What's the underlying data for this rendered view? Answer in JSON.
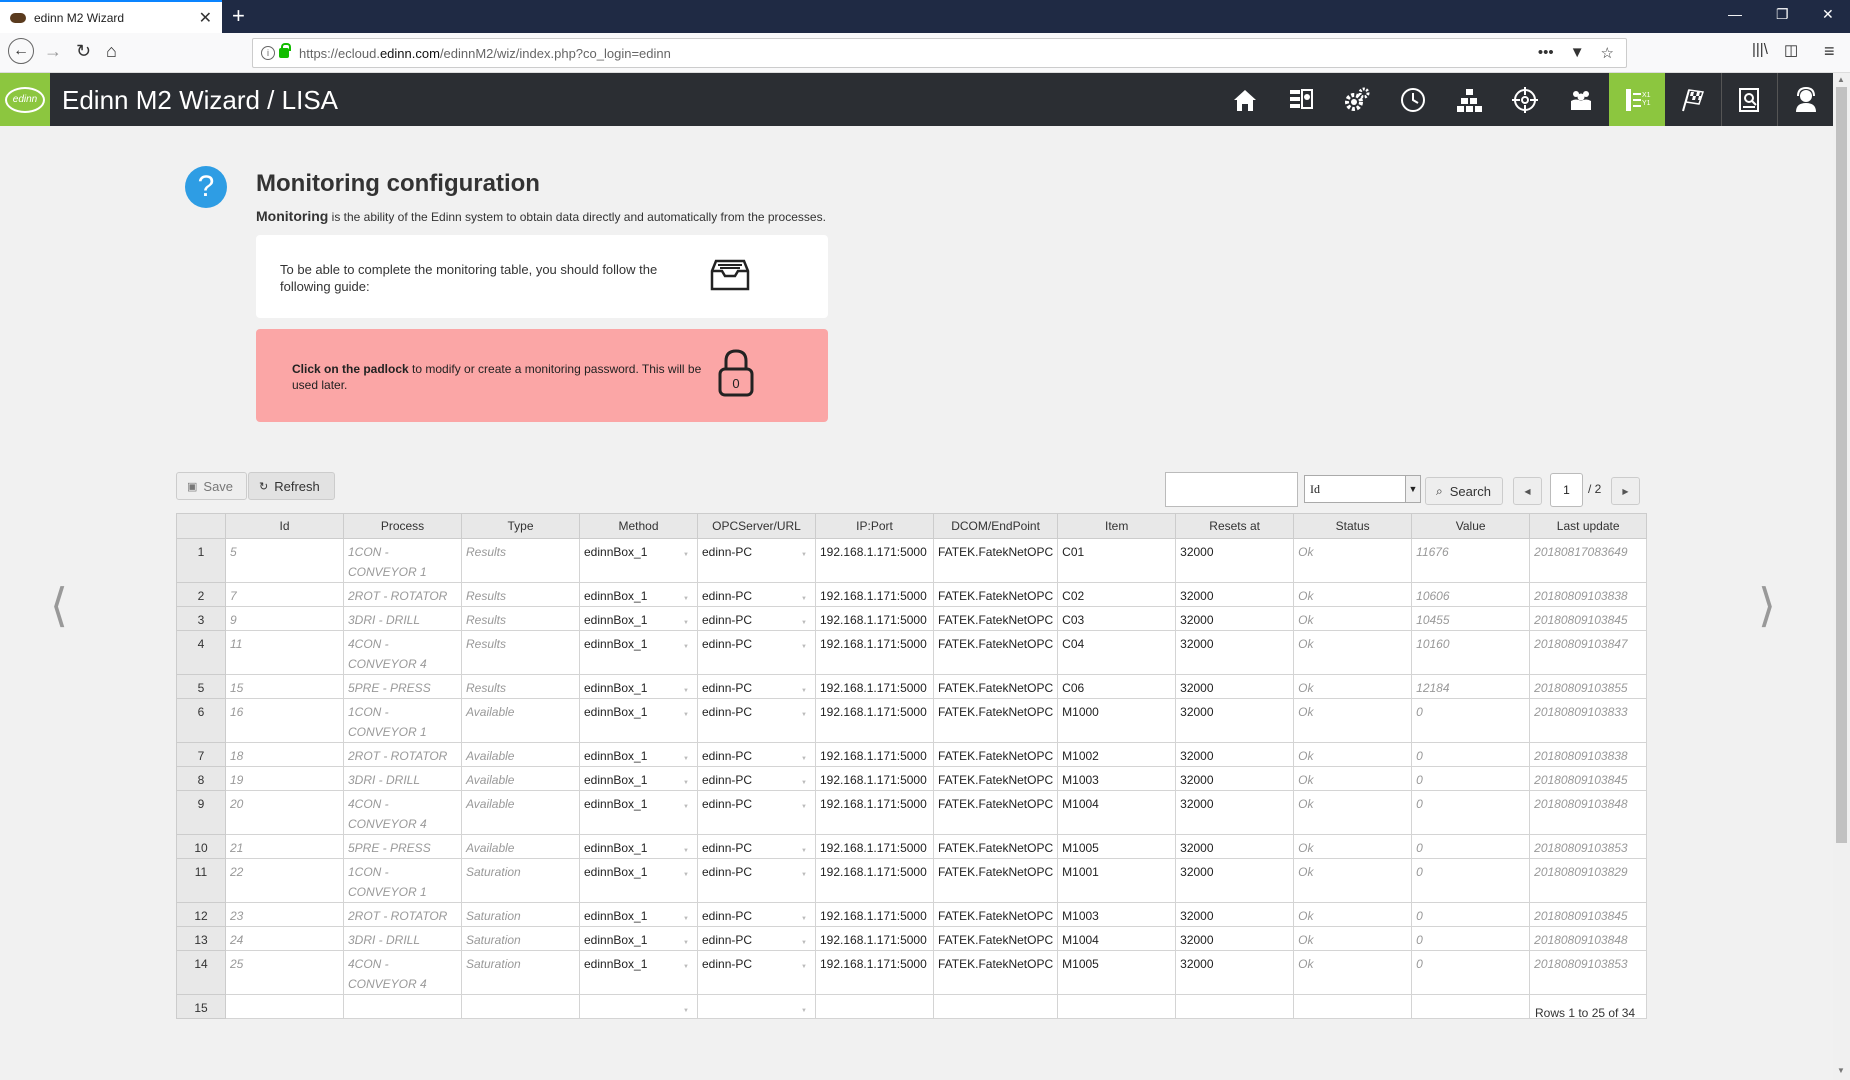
{
  "browser": {
    "tab_title": "edinn M2 Wizard",
    "url_prefix": "https://ecloud.",
    "url_domain": "edinn.com",
    "url_path": "/edinnM2/wiz/index.php?co_login=edinn"
  },
  "app": {
    "logo_text": "edinn",
    "title": "Edinn M2 Wizard / LISA",
    "nav_icons": [
      "home-icon",
      "dashboard-icon",
      "settings-gears-icon",
      "clock-icon",
      "hierarchy-icon",
      "target-icon",
      "users-icon",
      "monitoring-icon",
      "race-flag-icon",
      "report-icon",
      "support-icon"
    ],
    "active_icon": "monitoring-icon",
    "accent_color": "#8cc63f"
  },
  "page": {
    "title": "Monitoring configuration",
    "intro_bold": "Monitoring",
    "intro_rest": " is the ability of the Edinn system to obtain data directly and automatically from the processes.",
    "guide_text": "To be able to complete the monitoring table, you should follow the following guide:",
    "alert_bold": "Click on the padlock",
    "alert_rest": " to modify or create a monitoring password. This will be used later.",
    "padlock_number": "0",
    "alert_color": "#fba6a6"
  },
  "toolbar": {
    "save_label": "Save",
    "refresh_label": "Refresh",
    "search_value": "",
    "search_field": "Id",
    "search_label": "Search",
    "page_current": "1",
    "page_total": "/ 2"
  },
  "table": {
    "columns": [
      "",
      "Id",
      "Process",
      "Type",
      "Method",
      "OPCServer/URL",
      "IP:Port",
      "DCOM/EndPoint",
      "Item",
      "Resets at",
      "Status",
      "Value",
      "Last update"
    ],
    "rows": [
      {
        "n": "1",
        "id": "5",
        "process": "1CON - CONVEYOR 1",
        "type": "Results",
        "method": "edinnBox_1",
        "server": "edinn-PC",
        "ip": "192.168.1.171:5000",
        "dcom": "FATEK.FatekNetOPC",
        "item": "C01",
        "resets": "32000",
        "status": "Ok",
        "value": "11676",
        "updated": "20180817083649"
      },
      {
        "n": "2",
        "id": "7",
        "process": "2ROT - ROTATOR",
        "type": "Results",
        "method": "edinnBox_1",
        "server": "edinn-PC",
        "ip": "192.168.1.171:5000",
        "dcom": "FATEK.FatekNetOPC",
        "item": "C02",
        "resets": "32000",
        "status": "Ok",
        "value": "10606",
        "updated": "20180809103838"
      },
      {
        "n": "3",
        "id": "9",
        "process": "3DRI - DRILL",
        "type": "Results",
        "method": "edinnBox_1",
        "server": "edinn-PC",
        "ip": "192.168.1.171:5000",
        "dcom": "FATEK.FatekNetOPC",
        "item": "C03",
        "resets": "32000",
        "status": "Ok",
        "value": "10455",
        "updated": "20180809103845"
      },
      {
        "n": "4",
        "id": "11",
        "process": "4CON - CONVEYOR 4",
        "type": "Results",
        "method": "edinnBox_1",
        "server": "edinn-PC",
        "ip": "192.168.1.171:5000",
        "dcom": "FATEK.FatekNetOPC",
        "item": "C04",
        "resets": "32000",
        "status": "Ok",
        "value": "10160",
        "updated": "20180809103847"
      },
      {
        "n": "5",
        "id": "15",
        "process": "5PRE - PRESS",
        "type": "Results",
        "method": "edinnBox_1",
        "server": "edinn-PC",
        "ip": "192.168.1.171:5000",
        "dcom": "FATEK.FatekNetOPC",
        "item": "C06",
        "resets": "32000",
        "status": "Ok",
        "value": "12184",
        "updated": "20180809103855"
      },
      {
        "n": "6",
        "id": "16",
        "process": "1CON - CONVEYOR 1",
        "type": "Available",
        "method": "edinnBox_1",
        "server": "edinn-PC",
        "ip": "192.168.1.171:5000",
        "dcom": "FATEK.FatekNetOPC",
        "item": "M1000",
        "resets": "32000",
        "status": "Ok",
        "value": "0",
        "updated": "20180809103833"
      },
      {
        "n": "7",
        "id": "18",
        "process": "2ROT - ROTATOR",
        "type": "Available",
        "method": "edinnBox_1",
        "server": "edinn-PC",
        "ip": "192.168.1.171:5000",
        "dcom": "FATEK.FatekNetOPC",
        "item": "M1002",
        "resets": "32000",
        "status": "Ok",
        "value": "0",
        "updated": "20180809103838"
      },
      {
        "n": "8",
        "id": "19",
        "process": "3DRI - DRILL",
        "type": "Available",
        "method": "edinnBox_1",
        "server": "edinn-PC",
        "ip": "192.168.1.171:5000",
        "dcom": "FATEK.FatekNetOPC",
        "item": "M1003",
        "resets": "32000",
        "status": "Ok",
        "value": "0",
        "updated": "20180809103845"
      },
      {
        "n": "9",
        "id": "20",
        "process": "4CON - CONVEYOR 4",
        "type": "Available",
        "method": "edinnBox_1",
        "server": "edinn-PC",
        "ip": "192.168.1.171:5000",
        "dcom": "FATEK.FatekNetOPC",
        "item": "M1004",
        "resets": "32000",
        "status": "Ok",
        "value": "0",
        "updated": "20180809103848"
      },
      {
        "n": "10",
        "id": "21",
        "process": "5PRE - PRESS",
        "type": "Available",
        "method": "edinnBox_1",
        "server": "edinn-PC",
        "ip": "192.168.1.171:5000",
        "dcom": "FATEK.FatekNetOPC",
        "item": "M1005",
        "resets": "32000",
        "status": "Ok",
        "value": "0",
        "updated": "20180809103853"
      },
      {
        "n": "11",
        "id": "22",
        "process": "1CON - CONVEYOR 1",
        "type": "Saturation",
        "method": "edinnBox_1",
        "server": "edinn-PC",
        "ip": "192.168.1.171:5000",
        "dcom": "FATEK.FatekNetOPC",
        "item": "M1001",
        "resets": "32000",
        "status": "Ok",
        "value": "0",
        "updated": "20180809103829"
      },
      {
        "n": "12",
        "id": "23",
        "process": "2ROT - ROTATOR",
        "type": "Saturation",
        "method": "edinnBox_1",
        "server": "edinn-PC",
        "ip": "192.168.1.171:5000",
        "dcom": "FATEK.FatekNetOPC",
        "item": "M1003",
        "resets": "32000",
        "status": "Ok",
        "value": "0",
        "updated": "20180809103845"
      },
      {
        "n": "13",
        "id": "24",
        "process": "3DRI - DRILL",
        "type": "Saturation",
        "method": "edinnBox_1",
        "server": "edinn-PC",
        "ip": "192.168.1.171:5000",
        "dcom": "FATEK.FatekNetOPC",
        "item": "M1004",
        "resets": "32000",
        "status": "Ok",
        "value": "0",
        "updated": "20180809103848"
      },
      {
        "n": "14",
        "id": "25",
        "process": "4CON - CONVEYOR 4",
        "type": "Saturation",
        "method": "edinnBox_1",
        "server": "edinn-PC",
        "ip": "192.168.1.171:5000",
        "dcom": "FATEK.FatekNetOPC",
        "item": "M1005",
        "resets": "32000",
        "status": "Ok",
        "value": "0",
        "updated": "20180809103853"
      },
      {
        "n": "15",
        "id": "",
        "process": "",
        "type": "",
        "method": "",
        "server": "",
        "ip": "",
        "dcom": "",
        "item": "",
        "resets": "",
        "status": "",
        "value": "",
        "updated": ""
      }
    ],
    "rows_info": "Rows 1 to 25 of 34"
  }
}
